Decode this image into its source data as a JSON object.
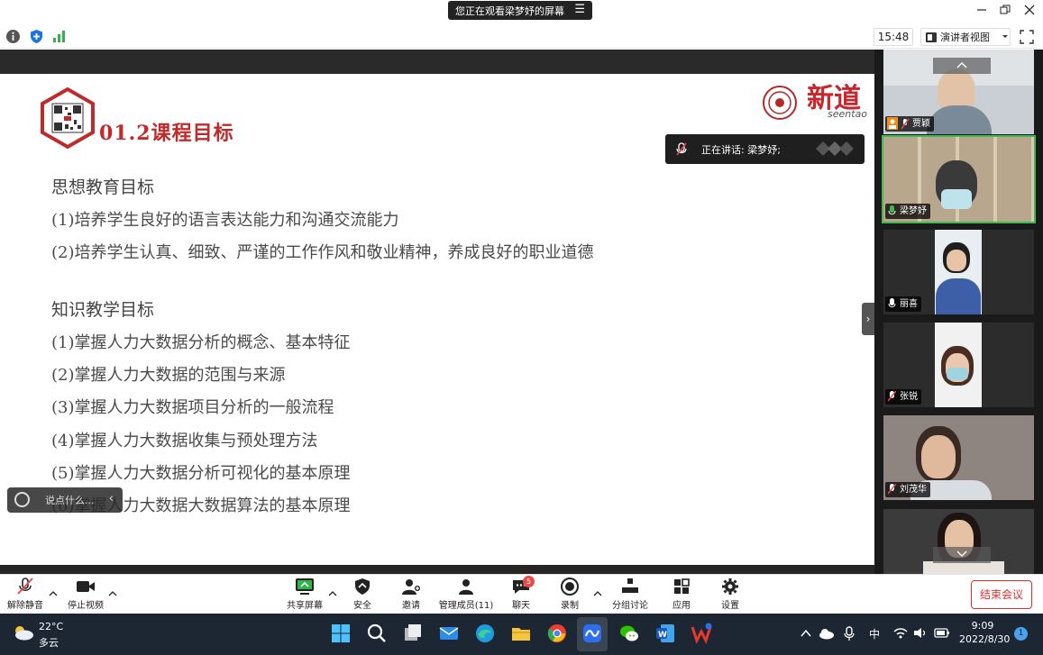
{
  "title_bar": {
    "share_status": "您正在观看梁梦妤的屏幕",
    "menu_glyph": "☰"
  },
  "info_bar": {
    "clock": "15:48",
    "view_label": "演讲者视图"
  },
  "slide": {
    "title": "01.2课程目标",
    "brand": "新道",
    "brand_sub": "seentao",
    "section_1": "思想教育目标",
    "section_1_items": [
      "(1)培养学生良好的语言表达能力和沟通交流能力",
      "(2)培养学生认真、细致、严谨的工作作风和敬业精神，养成良好的职业道德"
    ],
    "section_2": "知识教学目标",
    "section_2_items": [
      "(1)掌握人力大数据分析的概念、基本特征",
      "(2)掌握人力大数据的范围与来源",
      "(3)掌握人力大数据项目分析的一般流程",
      "(4)掌握人力大数据收集与预处理方法",
      "(5)掌握人力大数据分析可视化的基本原理",
      "(6)掌握人力大数据大数据算法的基本原理"
    ]
  },
  "speaking_banner": "正在讲话: 梁梦妤;",
  "chat_input": {
    "placeholder": "说点什么..."
  },
  "gallery": {
    "participants": [
      {
        "name": "贾颖",
        "speaking": false
      },
      {
        "name": "梁梦妤",
        "speaking": true
      },
      {
        "name": "丽喜",
        "speaking": false
      },
      {
        "name": "张锐",
        "speaking": false
      },
      {
        "name": "刘茂华",
        "speaking": false
      },
      {
        "name": "",
        "speaking": false
      }
    ]
  },
  "controls": {
    "unmute": "解除静音",
    "stop_video": "停止视频",
    "share_screen": "共享屏幕",
    "security": "安全",
    "invite": "邀请",
    "participants": "管理成员(11)",
    "chat": "聊天",
    "chat_badge": "5",
    "record": "录制",
    "breakout": "分组讨论",
    "apps": "应用",
    "settings": "设置",
    "end_meeting": "结束会议"
  },
  "taskbar": {
    "temperature": "22°C",
    "weather": "多云",
    "ime": "中",
    "time": "9:09",
    "date": "2022/8/30",
    "notifications": "1"
  },
  "colors": {
    "accent_red": "#c02a2a",
    "end_button": "#e02e2e",
    "speaking_green": "#3fb950",
    "taskbar_bg": "#1d2733"
  }
}
